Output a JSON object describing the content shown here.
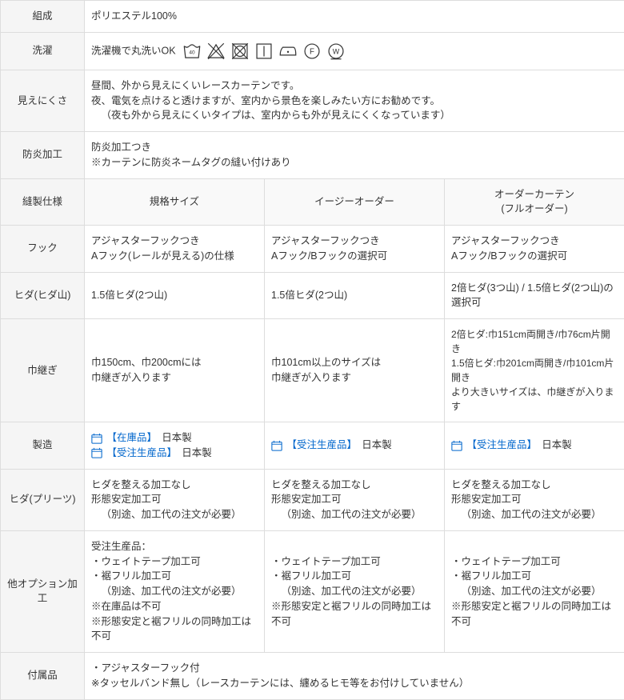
{
  "labels": {
    "composition": "組成",
    "washing": "洗濯",
    "visibility": "見えにくさ",
    "fire": "防炎加工",
    "sewing": "縫製仕様",
    "hook": "フック",
    "pleat_mt": "ヒダ(ヒダ山)",
    "width_join": "巾継ぎ",
    "manufacture": "製造",
    "pleat_crease": "ヒダ(プリーツ)",
    "options": "他オプション加工",
    "accessories": "付属品"
  },
  "composition_value": "ポリエステル100%",
  "washing_text": "洗濯機で丸洗いOK",
  "visibility_lines": {
    "l1": "昼間、外から見えにくいレースカーテンです。",
    "l2": "夜、電気を点けると透けますが、室内から景色を楽しみたい方にお勧めです。",
    "l3": "（夜も外から見えにくいタイプは、室内からも外が見えにくくなっています）"
  },
  "fire_lines": {
    "l1": "防炎加工つき",
    "l2": "※カーテンに防炎ネームタグの縫い付けあり"
  },
  "cols": {
    "standard": "規格サイズ",
    "easy": "イージーオーダー",
    "full_l1": "オーダーカーテン",
    "full_l2": "(フルオーダー)"
  },
  "hook": {
    "standard_l1": "アジャスターフックつき",
    "standard_l2": "Aフック(レールが見える)の仕様",
    "easy_l1": "アジャスターフックつき",
    "easy_l2": "Aフック/Bフックの選択可",
    "full_l1": "アジャスターフックつき",
    "full_l2": "Aフック/Bフックの選択可"
  },
  "pleat_mt": {
    "standard": "1.5倍ヒダ(2つ山)",
    "easy": "1.5倍ヒダ(2つ山)",
    "full": "2倍ヒダ(3つ山) / 1.5倍ヒダ(2つ山)の選択可"
  },
  "width_join": {
    "standard_l1": "巾150cm、巾200cmには",
    "standard_l2": "巾継ぎが入ります",
    "easy_l1": "巾101cm以上のサイズは",
    "easy_l2": "巾継ぎが入ります",
    "full_l1": "2倍ヒダ:巾151cm両開き/巾76cm片開き",
    "full_l2": "1.5倍ヒダ:巾201cm両開き/巾101cm片開き",
    "full_l3": "より大きいサイズは、巾継ぎが入ります"
  },
  "manufacture": {
    "stock_label": "【在庫品】",
    "mto_label": "【受注生産品】",
    "made_in": "日本製"
  },
  "pleat_crease": {
    "l1": "ヒダを整える加工なし",
    "l2": "形態安定加工可",
    "l3": "（別途、加工代の注文が必要）"
  },
  "options": {
    "std_l0": "受注生産品：",
    "weight": "・ウェイトテープ加工可",
    "frill": "・裾フリル加工可",
    "note_fee": "（別途、加工代の注文が必要）",
    "std_note1": "※在庫品は不可",
    "note_both": "※形態安定と裾フリルの同時加工は不可"
  },
  "accessories": {
    "l1": "・アジャスターフック付",
    "l2": "※タッセルバンド無し（レースカーテンには、纏めるヒモ等をお付けしていません）"
  }
}
